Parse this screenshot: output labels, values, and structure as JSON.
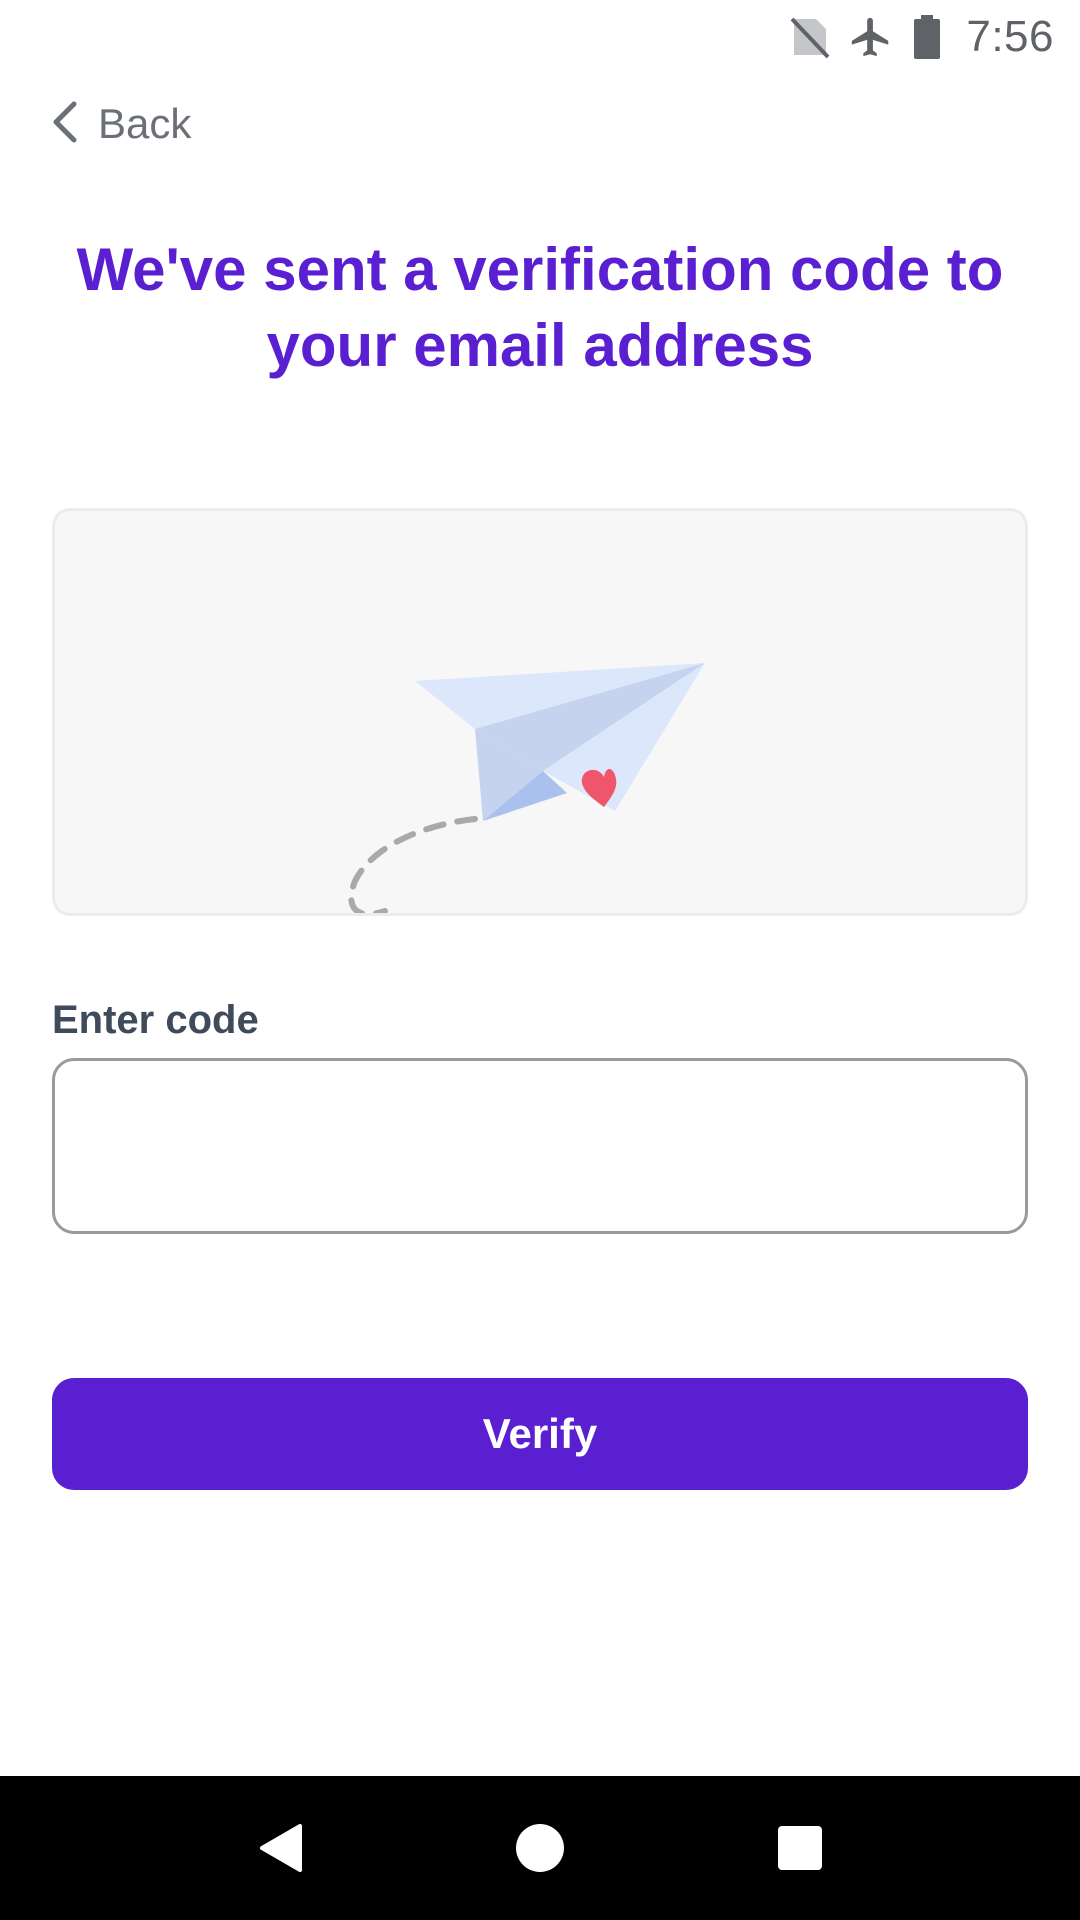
{
  "status_bar": {
    "time": "7:56",
    "icons": [
      "no-sim-icon",
      "airplane-mode-icon",
      "battery-icon"
    ]
  },
  "header": {
    "back_label": "Back",
    "back_icon": "chevron-left-icon"
  },
  "main": {
    "headline": "We've sent a verification code to your email address",
    "illustration": "paper-plane-heart-icon",
    "code_field": {
      "label": "Enter code",
      "value": "",
      "placeholder": ""
    },
    "verify_label": "Verify"
  },
  "nav_bar": {
    "icons": [
      "nav-back-icon",
      "nav-home-icon",
      "nav-recents-icon"
    ]
  },
  "colors": {
    "accent": "#5a1fd0",
    "label": "#3f4a5a",
    "heart": "#f0566b",
    "plane": "#dde7fb"
  }
}
